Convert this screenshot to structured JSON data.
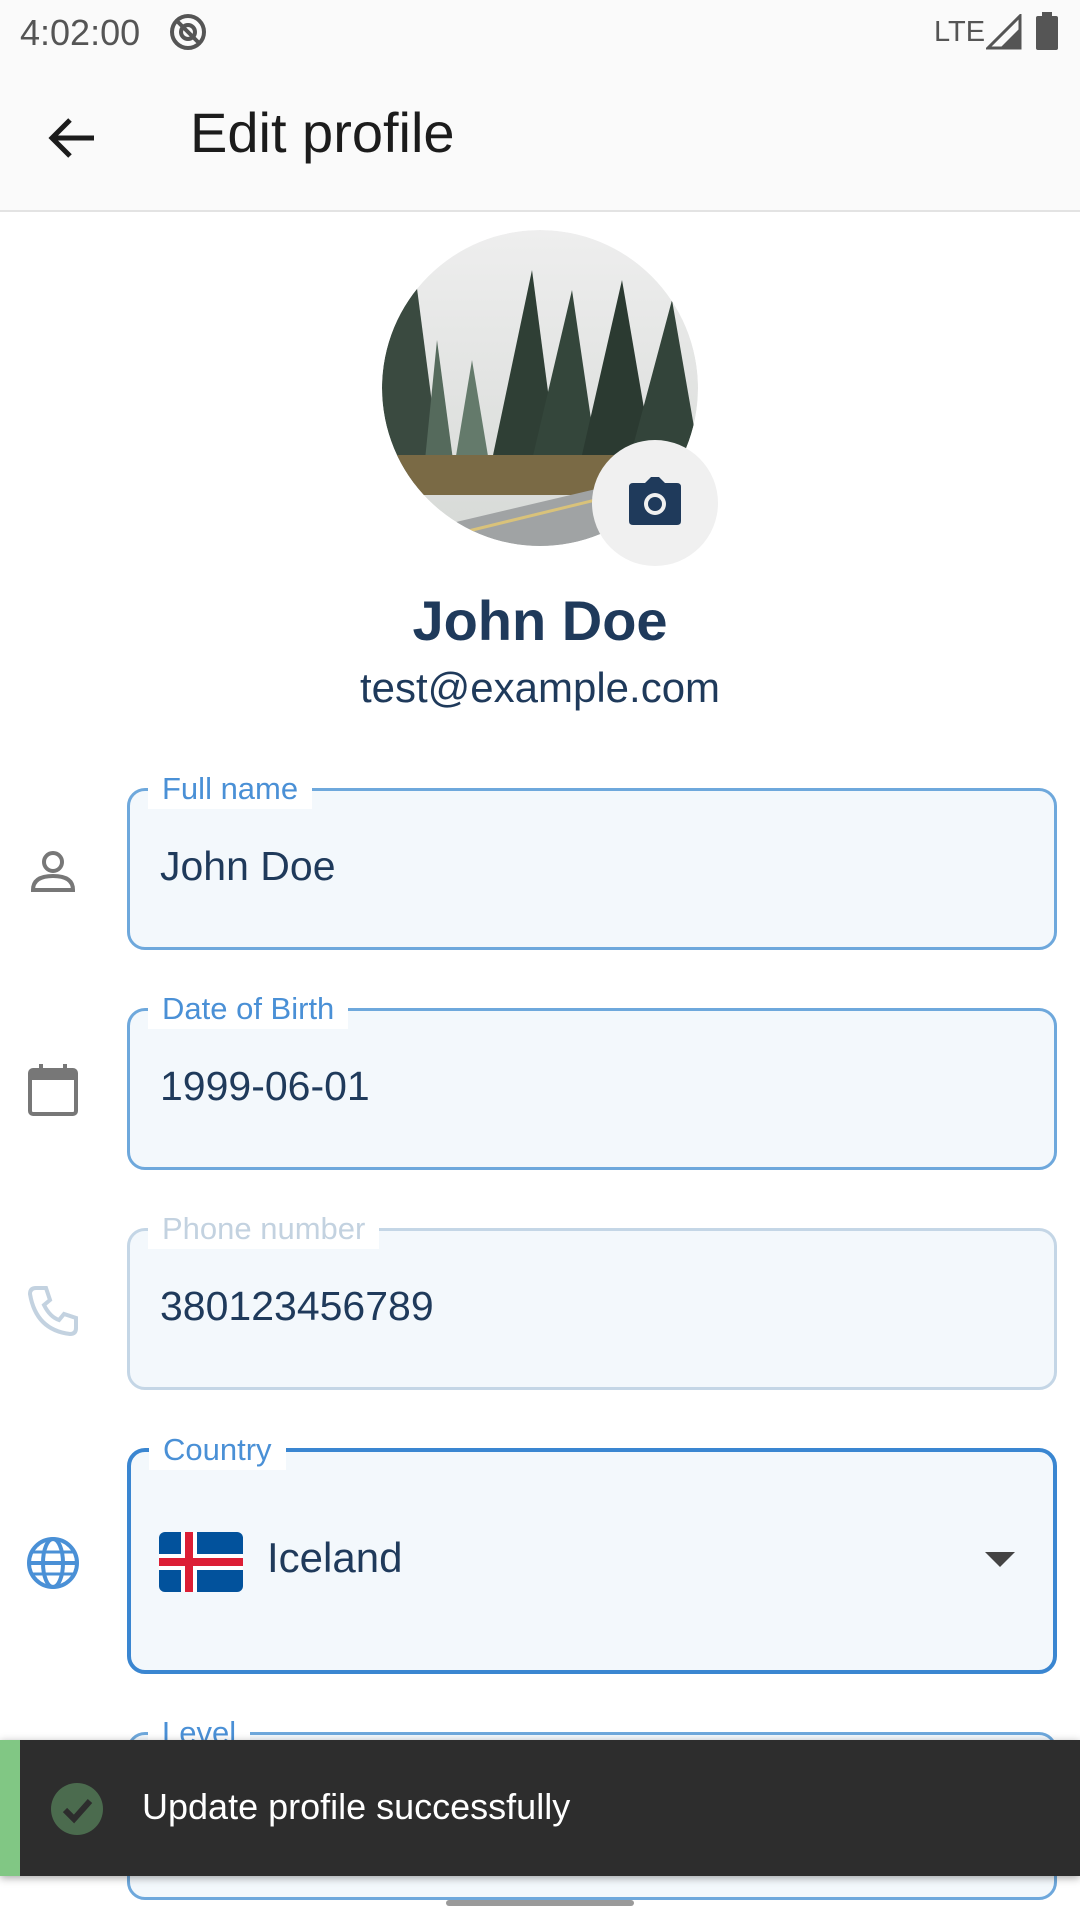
{
  "status_bar": {
    "time": "4:02:00",
    "network": "LTE"
  },
  "app_bar": {
    "title": "Edit profile",
    "back_icon": "arrow-back-icon"
  },
  "profile": {
    "name": "John Doe",
    "email": "test@example.com",
    "avatar_icon": "forest-road-photo",
    "camera_icon": "camera-icon"
  },
  "form": {
    "full_name": {
      "label": "Full name",
      "value": "John Doe",
      "icon": "person-icon"
    },
    "dob": {
      "label": "Date of Birth",
      "value": "1999-06-01",
      "icon": "calendar-icon"
    },
    "phone": {
      "label": "Phone number",
      "value": "380123456789",
      "icon": "phone-icon",
      "disabled": true
    },
    "country": {
      "label": "Country",
      "value": "Iceland",
      "icon": "globe-icon",
      "flag": "iceland-flag"
    },
    "level": {
      "label": "Level"
    }
  },
  "snackbar": {
    "message": "Update profile successfully",
    "icon": "check-circle-icon",
    "accent_color": "#81c784"
  },
  "colors": {
    "primary": "#1f3a5b",
    "accent": "#4a90d6",
    "field_bg": "#f3f8fc"
  }
}
